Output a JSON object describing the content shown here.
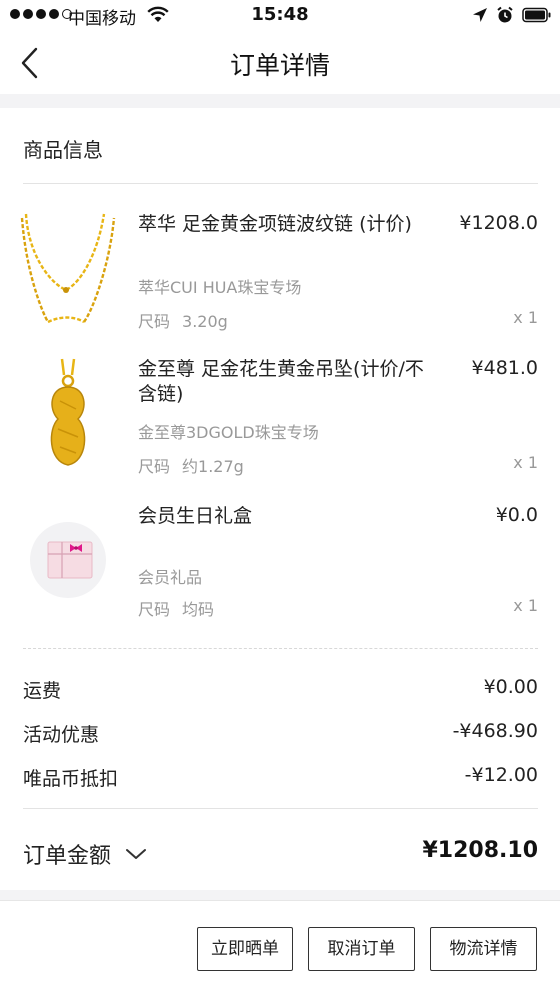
{
  "status_bar": {
    "carrier": "中国移动",
    "time": "15:48"
  },
  "nav": {
    "title": "订单详情"
  },
  "products_section": {
    "title": "商品信息",
    "items": [
      {
        "name": "萃华 足金黄金项链波纹链 (计价)",
        "price": "¥1208.0",
        "shop": "萃华CUI HUA珠宝专场",
        "spec_label": "尺码",
        "spec_value": "3.20g",
        "qty": "x 1",
        "icon": "gold-necklace-image"
      },
      {
        "name": "金至尊 足金花生黄金吊坠(计价/不含链)",
        "price": "¥481.0",
        "shop": "金至尊3DGOLD珠宝专场",
        "spec_label": "尺码",
        "spec_value": "约1.27g",
        "qty": "x 1",
        "icon": "gold-peanut-pendant-image"
      },
      {
        "name": "会员生日礼盒",
        "price": "¥0.0",
        "shop": "会员礼品",
        "spec_label": "尺码",
        "spec_value": "均码",
        "qty": "x 1",
        "icon": "gift-box-image"
      }
    ]
  },
  "fees": [
    {
      "label": "运费",
      "value": "¥0.00"
    },
    {
      "label": "活动优惠",
      "value": "-¥468.90"
    },
    {
      "label": "唯品币抵扣",
      "value": "-¥12.00"
    }
  ],
  "total": {
    "label": "订单金额",
    "amount": "¥1208.10"
  },
  "buttons": {
    "share": "立即晒单",
    "cancel": "取消订单",
    "logistics": "物流详情"
  },
  "colors": {
    "background_band": "#f3f3f5",
    "muted_text": "#999999",
    "gold": "#e8b515",
    "gift_pink": "#e0188a"
  }
}
